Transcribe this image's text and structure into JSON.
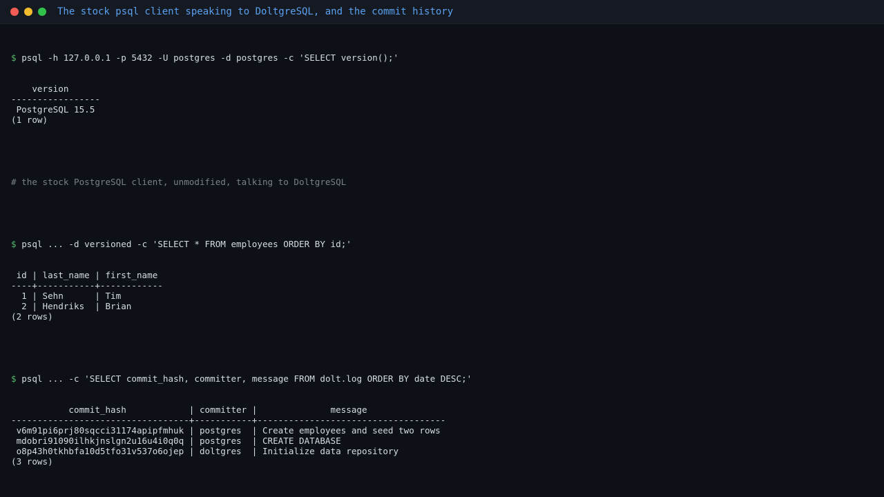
{
  "window": {
    "title": "The stock psql client speaking to DoltgreSQL, and the commit history",
    "title_color": "#5aa0f0",
    "controls": {
      "close_color": "#f25c54",
      "minimize_color": "#f3bb2e",
      "maximize_color": "#30c24a"
    }
  },
  "terminal": {
    "prompt_symbol": "$",
    "prompt_color": "#56b869",
    "text_color": "#d6dbe3",
    "comment_color": "#7a808a",
    "block1": {
      "command": "psql -h 127.0.0.1 -p 5432 -U postgres -d postgres -c 'SELECT version();'",
      "output": [
        "    version",
        "-----------------",
        " PostgreSQL 15.5",
        "(1 row)"
      ]
    },
    "comment": "# the stock PostgreSQL client, unmodified, talking to DoltgreSQL",
    "block2": {
      "command": "psql ... -d versioned -c 'SELECT * FROM employees ORDER BY id;'",
      "output": [
        " id | last_name | first_name",
        "----+-----------+------------",
        "  1 | Sehn      | Tim",
        "  2 | Hendriks  | Brian",
        "(2 rows)"
      ]
    },
    "block3": {
      "command": "psql ... -c 'SELECT commit_hash, committer, message FROM dolt.log ORDER BY date DESC;'",
      "output": [
        "           commit_hash            | committer |              message",
        "----------------------------------+-----------+------------------------------------",
        " v6m91pi6prj80sqcci31174apipfmhuk | postgres  | Create employees and seed two rows",
        " mdobri91090ilhkjnslgn2u16u4i0q0q | postgres  | CREATE DATABASE",
        " o8p43h0tkhbfa10d5tfo31v537o6ojep | doltgres  | Initialize data repository",
        "(3 rows)"
      ]
    }
  }
}
